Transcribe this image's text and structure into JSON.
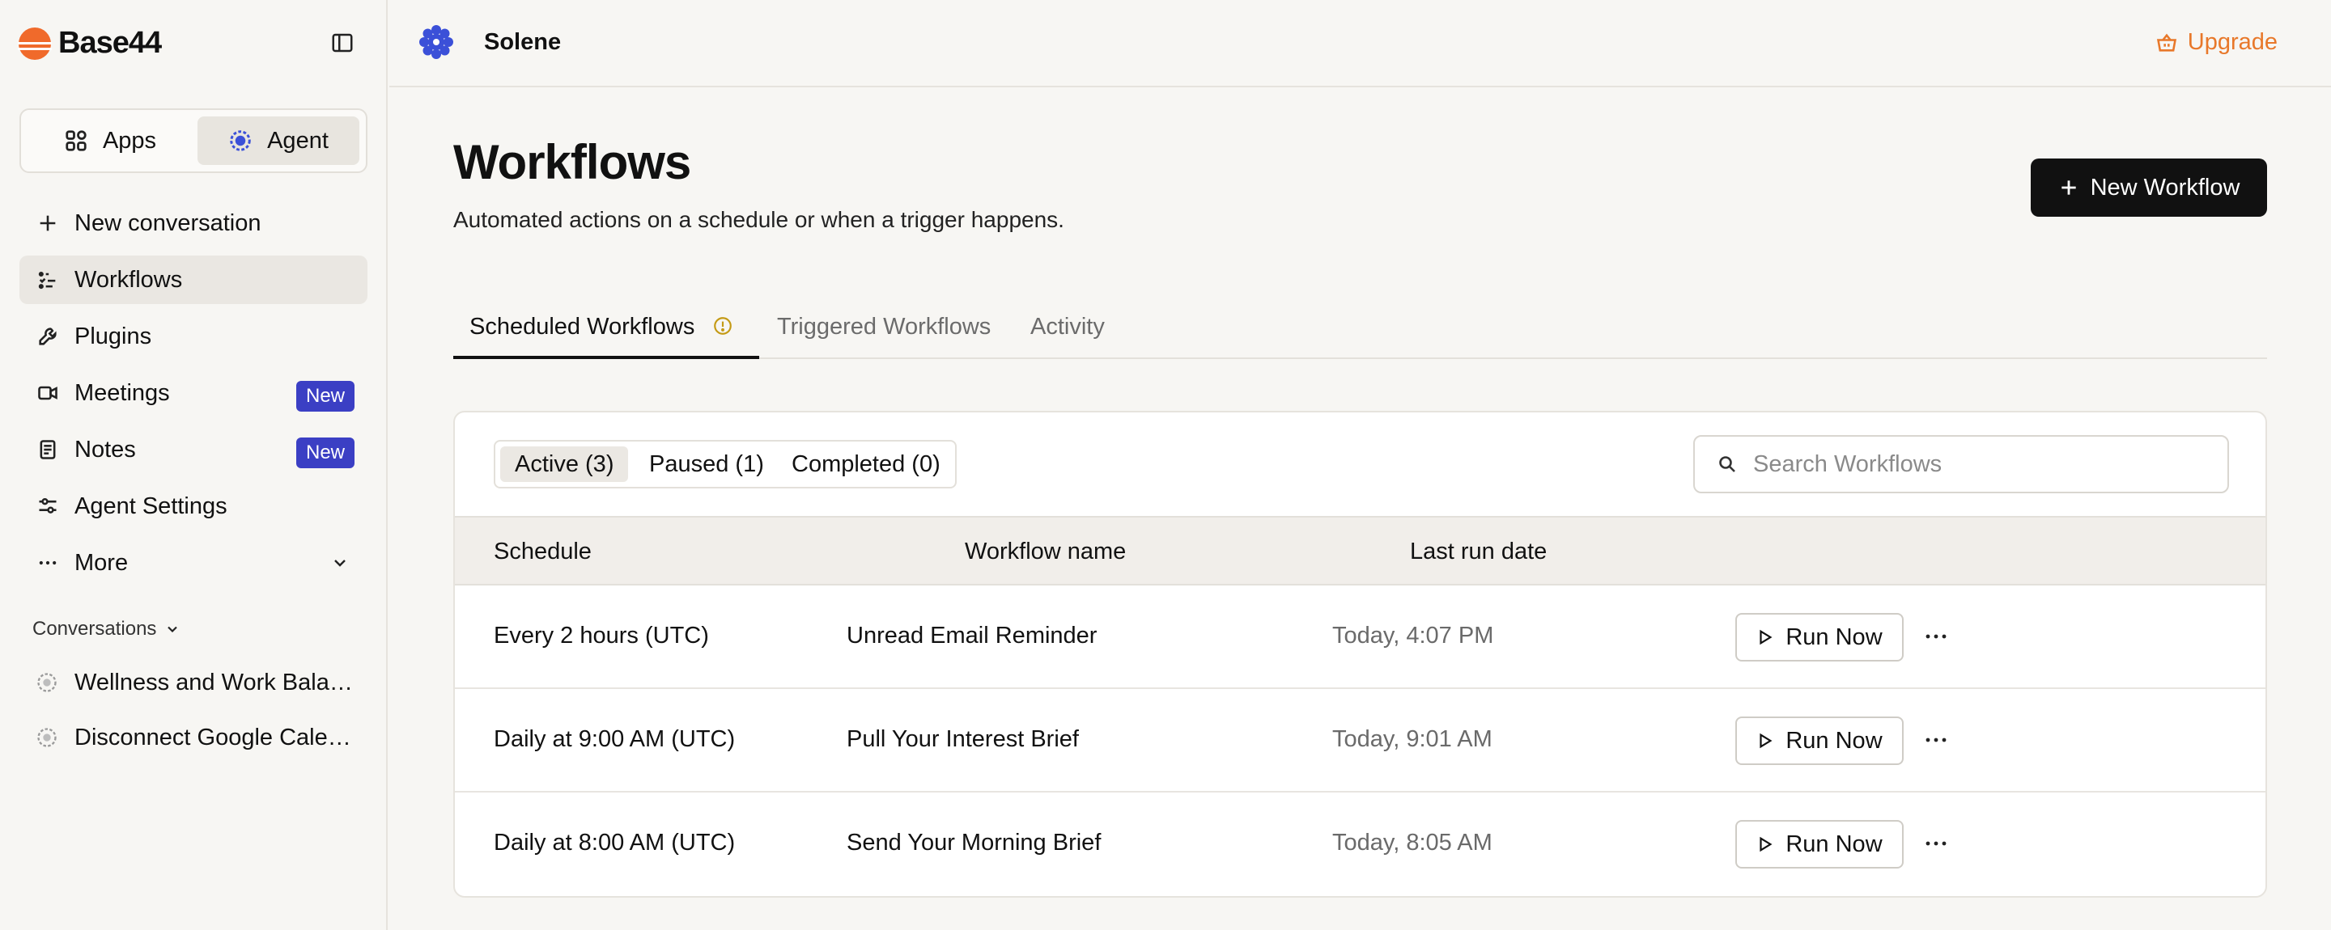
{
  "brand": {
    "name": "Base44",
    "accent": "#e8782a"
  },
  "sidebar": {
    "mode_toggle": {
      "apps_label": "Apps",
      "agent_label": "Agent",
      "selected": "Agent"
    },
    "items": [
      {
        "label": "New conversation",
        "icon": "plus-icon"
      },
      {
        "label": "Workflows",
        "icon": "workflow-icon",
        "active": true
      },
      {
        "label": "Plugins",
        "icon": "wrench-icon"
      },
      {
        "label": "Meetings",
        "icon": "video-icon",
        "badge": "New"
      },
      {
        "label": "Notes",
        "icon": "note-icon",
        "badge": "New"
      },
      {
        "label": "Agent Settings",
        "icon": "sliders-icon"
      },
      {
        "label": "More",
        "icon": "dots-icon"
      }
    ],
    "conversations_label": "Conversations",
    "conversations": [
      {
        "title": "Wellness and Work Balance"
      },
      {
        "title": "Disconnect Google Calendar"
      }
    ]
  },
  "topbar": {
    "agent_name": "Solene",
    "upgrade_label": "Upgrade"
  },
  "page": {
    "title": "Workflows",
    "subtitle": "Automated actions on a schedule or when a trigger happens.",
    "new_button_label": "New Workflow"
  },
  "tabs": [
    {
      "label": "Scheduled Workflows",
      "active": true
    },
    {
      "label": "Triggered Workflows"
    },
    {
      "label": "Activity"
    }
  ],
  "filters": [
    {
      "label": "Active (3)",
      "active": true
    },
    {
      "label": "Paused (1)"
    },
    {
      "label": "Completed (0)"
    }
  ],
  "search": {
    "placeholder": "Search Workflows",
    "value": ""
  },
  "table": {
    "columns": [
      "Schedule",
      "Workflow name",
      "Last run date"
    ],
    "run_label": "Run Now",
    "rows": [
      {
        "schedule": "Every 2 hours (UTC)",
        "name": "Unread Email Reminder",
        "last_run": "Today, 4:07 PM"
      },
      {
        "schedule": "Daily at 9:00 AM (UTC)",
        "name": "Pull Your Interest Brief",
        "last_run": "Today, 9:01 AM"
      },
      {
        "schedule": "Daily at 8:00 AM (UTC)",
        "name": "Send Your Morning Brief",
        "last_run": "Today, 8:05 AM"
      }
    ]
  }
}
